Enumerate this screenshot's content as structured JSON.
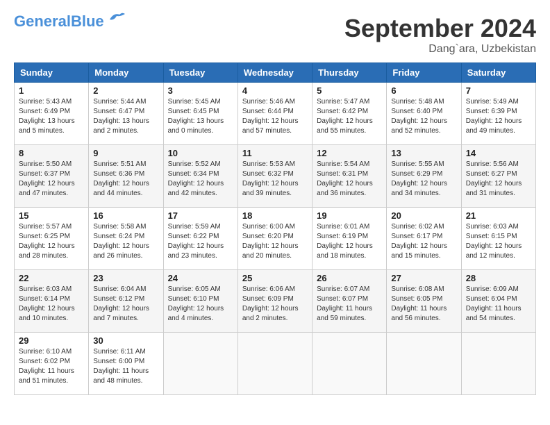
{
  "header": {
    "logo_general": "General",
    "logo_blue": "Blue",
    "month": "September 2024",
    "location": "Dang`ara, Uzbekistan"
  },
  "days_of_week": [
    "Sunday",
    "Monday",
    "Tuesday",
    "Wednesday",
    "Thursday",
    "Friday",
    "Saturday"
  ],
  "weeks": [
    [
      {
        "day": "1",
        "sunrise": "5:43 AM",
        "sunset": "6:49 PM",
        "daylight": "13 hours and 5 minutes."
      },
      {
        "day": "2",
        "sunrise": "5:44 AM",
        "sunset": "6:47 PM",
        "daylight": "13 hours and 2 minutes."
      },
      {
        "day": "3",
        "sunrise": "5:45 AM",
        "sunset": "6:45 PM",
        "daylight": "13 hours and 0 minutes."
      },
      {
        "day": "4",
        "sunrise": "5:46 AM",
        "sunset": "6:44 PM",
        "daylight": "12 hours and 57 minutes."
      },
      {
        "day": "5",
        "sunrise": "5:47 AM",
        "sunset": "6:42 PM",
        "daylight": "12 hours and 55 minutes."
      },
      {
        "day": "6",
        "sunrise": "5:48 AM",
        "sunset": "6:40 PM",
        "daylight": "12 hours and 52 minutes."
      },
      {
        "day": "7",
        "sunrise": "5:49 AM",
        "sunset": "6:39 PM",
        "daylight": "12 hours and 49 minutes."
      }
    ],
    [
      {
        "day": "8",
        "sunrise": "5:50 AM",
        "sunset": "6:37 PM",
        "daylight": "12 hours and 47 minutes."
      },
      {
        "day": "9",
        "sunrise": "5:51 AM",
        "sunset": "6:36 PM",
        "daylight": "12 hours and 44 minutes."
      },
      {
        "day": "10",
        "sunrise": "5:52 AM",
        "sunset": "6:34 PM",
        "daylight": "12 hours and 42 minutes."
      },
      {
        "day": "11",
        "sunrise": "5:53 AM",
        "sunset": "6:32 PM",
        "daylight": "12 hours and 39 minutes."
      },
      {
        "day": "12",
        "sunrise": "5:54 AM",
        "sunset": "6:31 PM",
        "daylight": "12 hours and 36 minutes."
      },
      {
        "day": "13",
        "sunrise": "5:55 AM",
        "sunset": "6:29 PM",
        "daylight": "12 hours and 34 minutes."
      },
      {
        "day": "14",
        "sunrise": "5:56 AM",
        "sunset": "6:27 PM",
        "daylight": "12 hours and 31 minutes."
      }
    ],
    [
      {
        "day": "15",
        "sunrise": "5:57 AM",
        "sunset": "6:25 PM",
        "daylight": "12 hours and 28 minutes."
      },
      {
        "day": "16",
        "sunrise": "5:58 AM",
        "sunset": "6:24 PM",
        "daylight": "12 hours and 26 minutes."
      },
      {
        "day": "17",
        "sunrise": "5:59 AM",
        "sunset": "6:22 PM",
        "daylight": "12 hours and 23 minutes."
      },
      {
        "day": "18",
        "sunrise": "6:00 AM",
        "sunset": "6:20 PM",
        "daylight": "12 hours and 20 minutes."
      },
      {
        "day": "19",
        "sunrise": "6:01 AM",
        "sunset": "6:19 PM",
        "daylight": "12 hours and 18 minutes."
      },
      {
        "day": "20",
        "sunrise": "6:02 AM",
        "sunset": "6:17 PM",
        "daylight": "12 hours and 15 minutes."
      },
      {
        "day": "21",
        "sunrise": "6:03 AM",
        "sunset": "6:15 PM",
        "daylight": "12 hours and 12 minutes."
      }
    ],
    [
      {
        "day": "22",
        "sunrise": "6:03 AM",
        "sunset": "6:14 PM",
        "daylight": "12 hours and 10 minutes."
      },
      {
        "day": "23",
        "sunrise": "6:04 AM",
        "sunset": "6:12 PM",
        "daylight": "12 hours and 7 minutes."
      },
      {
        "day": "24",
        "sunrise": "6:05 AM",
        "sunset": "6:10 PM",
        "daylight": "12 hours and 4 minutes."
      },
      {
        "day": "25",
        "sunrise": "6:06 AM",
        "sunset": "6:09 PM",
        "daylight": "12 hours and 2 minutes."
      },
      {
        "day": "26",
        "sunrise": "6:07 AM",
        "sunset": "6:07 PM",
        "daylight": "11 hours and 59 minutes."
      },
      {
        "day": "27",
        "sunrise": "6:08 AM",
        "sunset": "6:05 PM",
        "daylight": "11 hours and 56 minutes."
      },
      {
        "day": "28",
        "sunrise": "6:09 AM",
        "sunset": "6:04 PM",
        "daylight": "11 hours and 54 minutes."
      }
    ],
    [
      {
        "day": "29",
        "sunrise": "6:10 AM",
        "sunset": "6:02 PM",
        "daylight": "11 hours and 51 minutes."
      },
      {
        "day": "30",
        "sunrise": "6:11 AM",
        "sunset": "6:00 PM",
        "daylight": "11 hours and 48 minutes."
      },
      null,
      null,
      null,
      null,
      null
    ]
  ]
}
